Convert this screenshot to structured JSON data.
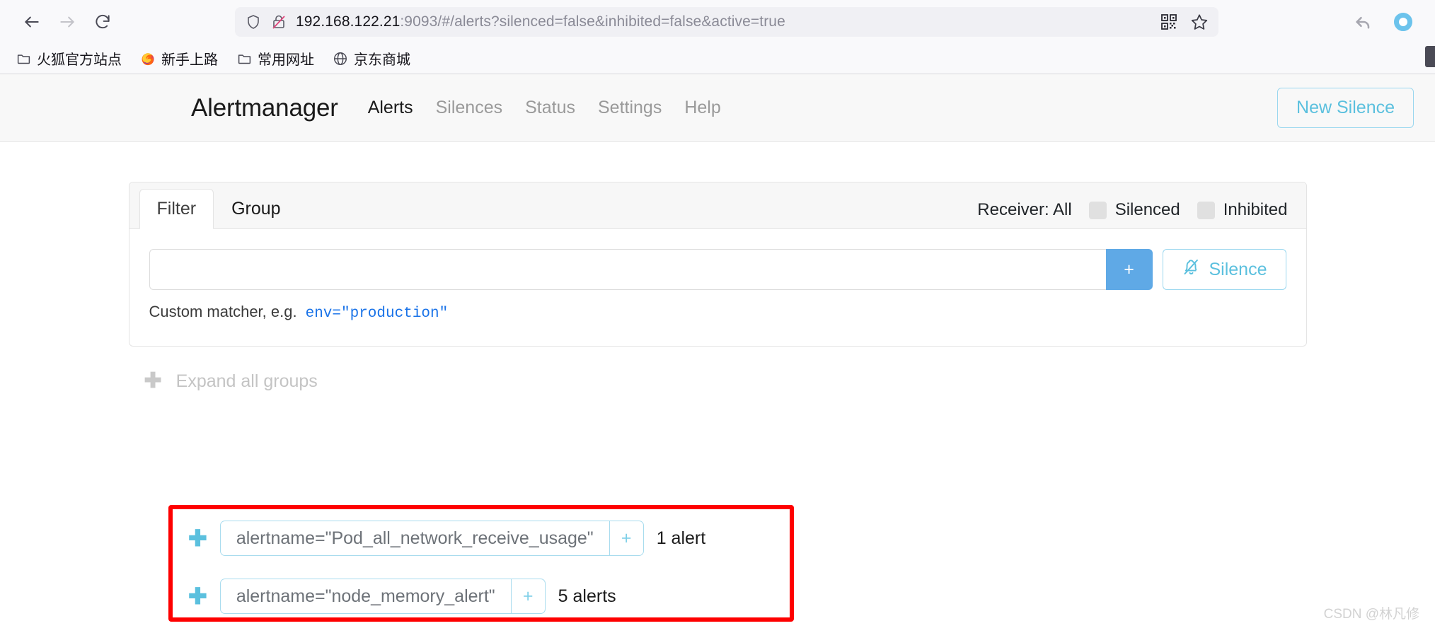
{
  "browser": {
    "nav": {
      "back_icon": "arrow-left-icon",
      "forward_icon": "arrow-right-icon",
      "reload_icon": "reload-icon"
    },
    "url": {
      "host": "192.168.122.21",
      "path": ":9093/#/alerts?silenced=false&inhibited=false&active=true",
      "full": "192.168.122.21:9093/#/alerts?silenced=false&inhibited=false&active=true",
      "shield_icon": "shield-icon",
      "lock_broken_icon": "lock-slashed-icon",
      "qr_icon": "qr-code-icon",
      "bookmark_icon": "star-icon"
    },
    "toolbar_right": {
      "undo_icon": "undo-arrow-icon",
      "account_icon": "circle-icon"
    },
    "bookmarks": [
      {
        "label": "火狐官方站点",
        "icon": "folder-icon"
      },
      {
        "label": "新手上路",
        "icon": "firefox-icon"
      },
      {
        "label": "常用网址",
        "icon": "folder-icon"
      },
      {
        "label": "京东商城",
        "icon": "globe-icon"
      }
    ]
  },
  "app": {
    "brand": "Alertmanager",
    "nav_links": [
      {
        "label": "Alerts",
        "active": true
      },
      {
        "label": "Silences",
        "active": false
      },
      {
        "label": "Status",
        "active": false
      },
      {
        "label": "Settings",
        "active": false
      },
      {
        "label": "Help",
        "active": false
      }
    ],
    "new_silence_button": "New Silence"
  },
  "filter_card": {
    "tabs": [
      {
        "label": "Filter",
        "active": true
      },
      {
        "label": "Group",
        "active": false
      }
    ],
    "receiver_label": "Receiver: All",
    "checkboxes": [
      {
        "label": "Silenced",
        "checked": false
      },
      {
        "label": "Inhibited",
        "checked": false
      }
    ],
    "matcher_input": {
      "value": "",
      "placeholder": ""
    },
    "add_button": "+",
    "silence_button": "Silence",
    "silence_button_icon": "bell-slash-icon",
    "hint_prefix": "Custom matcher, e.g.",
    "hint_example": "env=\"production\""
  },
  "groups": {
    "expand_all_label": "Expand all groups",
    "expand_all_icon": "plus-icon",
    "rows": [
      {
        "expand_icon": "plus-icon",
        "matcher": "alertname=\"Pod_all_network_receive_usage\"",
        "pill_plus": "+",
        "count": "1 alert"
      },
      {
        "expand_icon": "plus-icon",
        "matcher": "alertname=\"node_memory_alert\"",
        "pill_plus": "+",
        "count": "5 alerts"
      }
    ]
  },
  "watermark": "CSDN @林凡修",
  "colors": {
    "accent_blue": "#5bc0de",
    "button_blue": "#5fa9e6",
    "link_blue": "#1a73e8",
    "highlight_red": "#fe0000"
  }
}
